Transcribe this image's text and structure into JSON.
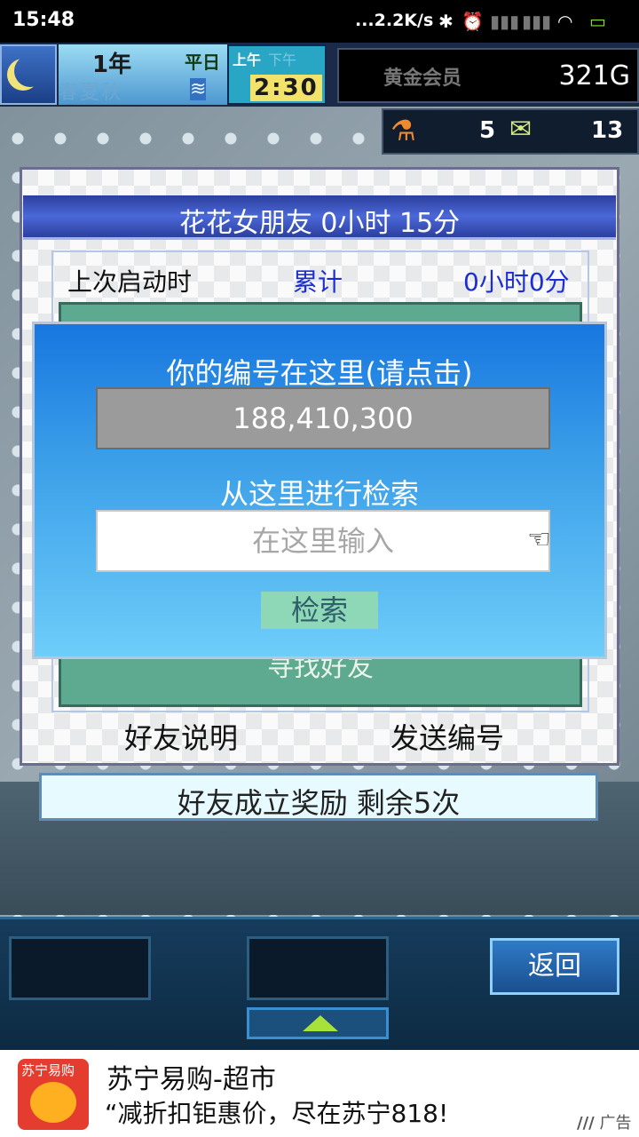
{
  "statusbar": {
    "time": "15:48",
    "net_speed": "...2.2K/s",
    "bt": "✱",
    "alarm": "⏰",
    "signal": "▮▮▮",
    "wifi": "◠",
    "battery": "▭"
  },
  "hud": {
    "year": "1年",
    "season_ghost": "春夏秋",
    "day_type": "平日",
    "season_icon": "≋",
    "am": "上午",
    "pm": "下午",
    "clock": "2:30",
    "membership": "黄金会员",
    "gold": "321G",
    "research_points": "5",
    "tickets": "13",
    "flask_icon": "⚗",
    "ticket_icon": "✉"
  },
  "panel": {
    "title": "花花女朋友  0小时 15分",
    "last_launch_label": "上次启动时",
    "total_label": "累计",
    "total_value": "0小时0分",
    "find_friend": "寻找好友",
    "explain_link": "好友说明",
    "send_number_link": "发送编号",
    "bonus": "好友成立奖励  剩余5次"
  },
  "modal": {
    "title": "你的编号在这里(请点击)",
    "id_value": "188,410,300",
    "search_title": "从这里进行检索",
    "search_placeholder": "在这里输入",
    "search_button": "检索",
    "pointer_icon": "☜"
  },
  "bottom": {
    "back_button": "返回"
  },
  "ad": {
    "brand": "苏宁易购",
    "title": "苏宁易购-超市",
    "text": "“减折扣钜惠价，尽在苏宁818!",
    "tag": "广告",
    "tag_mark": "///"
  }
}
